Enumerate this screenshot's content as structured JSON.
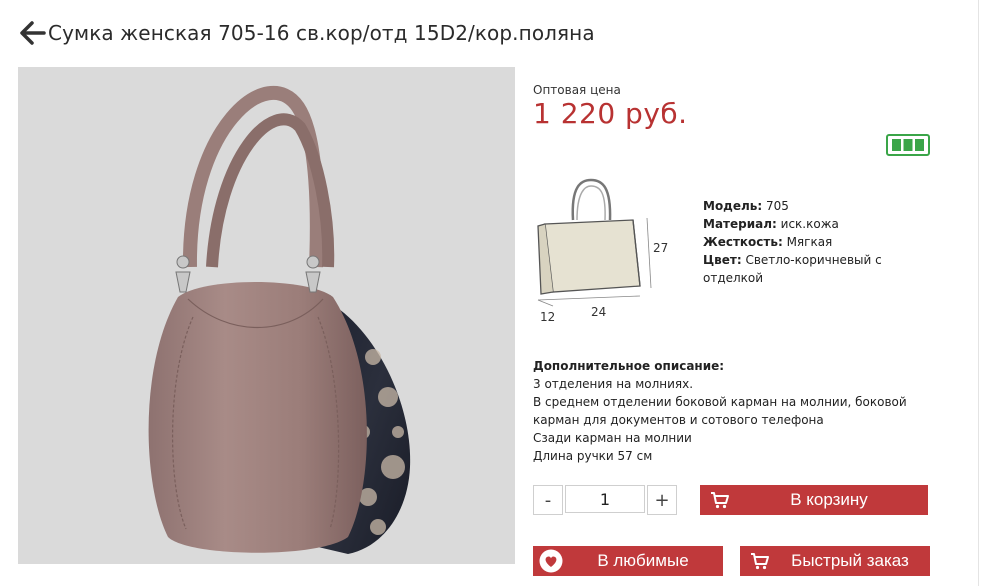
{
  "product": {
    "title": "Сумка женская 705-16 св.кор/отд 15D2/кор.поляна",
    "price_label": "Оптовая цена",
    "price": "1 220 руб.",
    "stock_level": 1.0
  },
  "dimensions": {
    "height": "27",
    "depth": "12",
    "width": "24"
  },
  "specs": [
    {
      "key": "Модель:",
      "value": "705"
    },
    {
      "key": "Материал:",
      "value": "иск.кожа"
    },
    {
      "key": "Жесткость:",
      "value": "Мягкая"
    },
    {
      "key": "Цвет:",
      "value": "Светло-коричневый с отделкой"
    }
  ],
  "description": {
    "title": "Дополнительное описание:",
    "lines": [
      "3 отделения на молниях.",
      "В среднем отделении боковой карман на молнии, боковой карман для документов и сотового телефона",
      "Сзади карман на молнии",
      "Длина ручки 57 см"
    ]
  },
  "cart": {
    "minus": "-",
    "quantity": "1",
    "plus": "+",
    "add_to_cart": "В корзину",
    "favorites": "В любимые",
    "quick_order": "Быстрый заказ"
  },
  "colors": {
    "accent": "#c0393b",
    "price": "#b83232",
    "stock": "#3aa548"
  },
  "icons": [
    "arrow-left-icon",
    "stock-battery-icon",
    "cart-icon",
    "heart-icon"
  ]
}
